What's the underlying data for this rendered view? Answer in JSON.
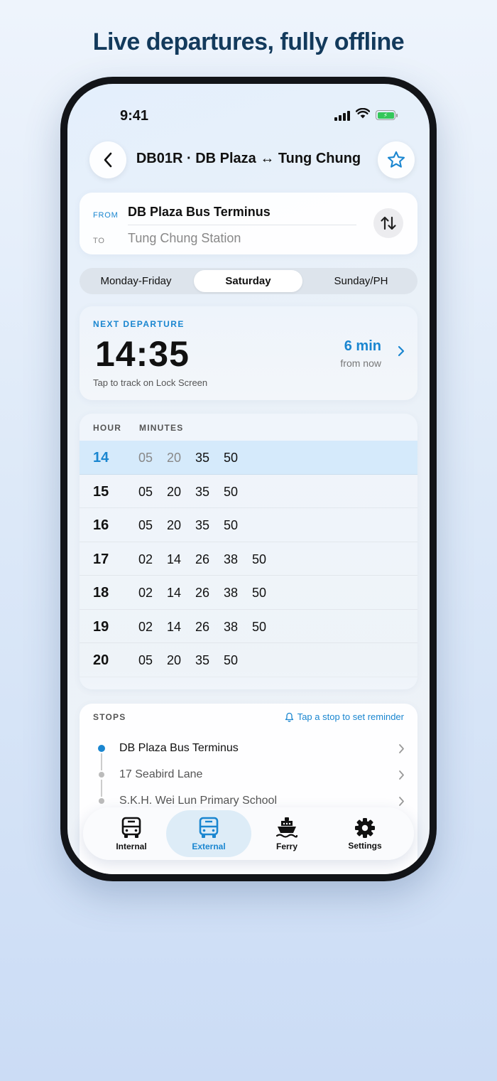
{
  "headline": "Live departures, fully offline",
  "status": {
    "time": "9:41"
  },
  "nav": {
    "title": "DB01R · DB Plaza ↔ Tung Chung"
  },
  "route": {
    "from_label": "FROM",
    "from_value": "DB Plaza Bus Terminus",
    "to_label": "TO",
    "to_value": "Tung Chung Station"
  },
  "day_tabs": [
    {
      "label": "Monday-Friday"
    },
    {
      "label": "Saturday",
      "selected": true
    },
    {
      "label": "Sunday/PH"
    }
  ],
  "next_departure": {
    "label": "NEXT DEPARTURE",
    "time": "14:35",
    "in": "6 min",
    "from_now": "from now",
    "hint": "Tap to track on Lock Screen"
  },
  "timetable": {
    "hour_header": "HOUR",
    "minutes_header": "MINUTES",
    "rows": [
      {
        "hour": "14",
        "minutes": [
          "05",
          "20",
          "35",
          "50"
        ]
      },
      {
        "hour": "15",
        "minutes": [
          "05",
          "20",
          "35",
          "50"
        ]
      },
      {
        "hour": "16",
        "minutes": [
          "05",
          "20",
          "35",
          "50"
        ]
      },
      {
        "hour": "17",
        "minutes": [
          "02",
          "14",
          "26",
          "38",
          "50"
        ]
      },
      {
        "hour": "18",
        "minutes": [
          "02",
          "14",
          "26",
          "38",
          "50"
        ]
      },
      {
        "hour": "19",
        "minutes": [
          "02",
          "14",
          "26",
          "38",
          "50"
        ]
      },
      {
        "hour": "20",
        "minutes": [
          "05",
          "20",
          "35",
          "50"
        ]
      }
    ]
  },
  "stops": {
    "header": "STOPS",
    "hint": "Tap a stop to set reminder",
    "items": [
      "DB Plaza Bus Terminus",
      "17 Seabird Lane",
      "S.K.H. Wei Lun Primary School"
    ]
  },
  "tabbar": [
    {
      "label": "Internal",
      "icon": "bus-icon"
    },
    {
      "label": "External",
      "icon": "bus-icon",
      "selected": true
    },
    {
      "label": "Ferry",
      "icon": "ferry-icon"
    },
    {
      "label": "Settings",
      "icon": "gear-icon"
    }
  ],
  "colors": {
    "accent": "#1a86d0",
    "battery": "#34c759"
  }
}
